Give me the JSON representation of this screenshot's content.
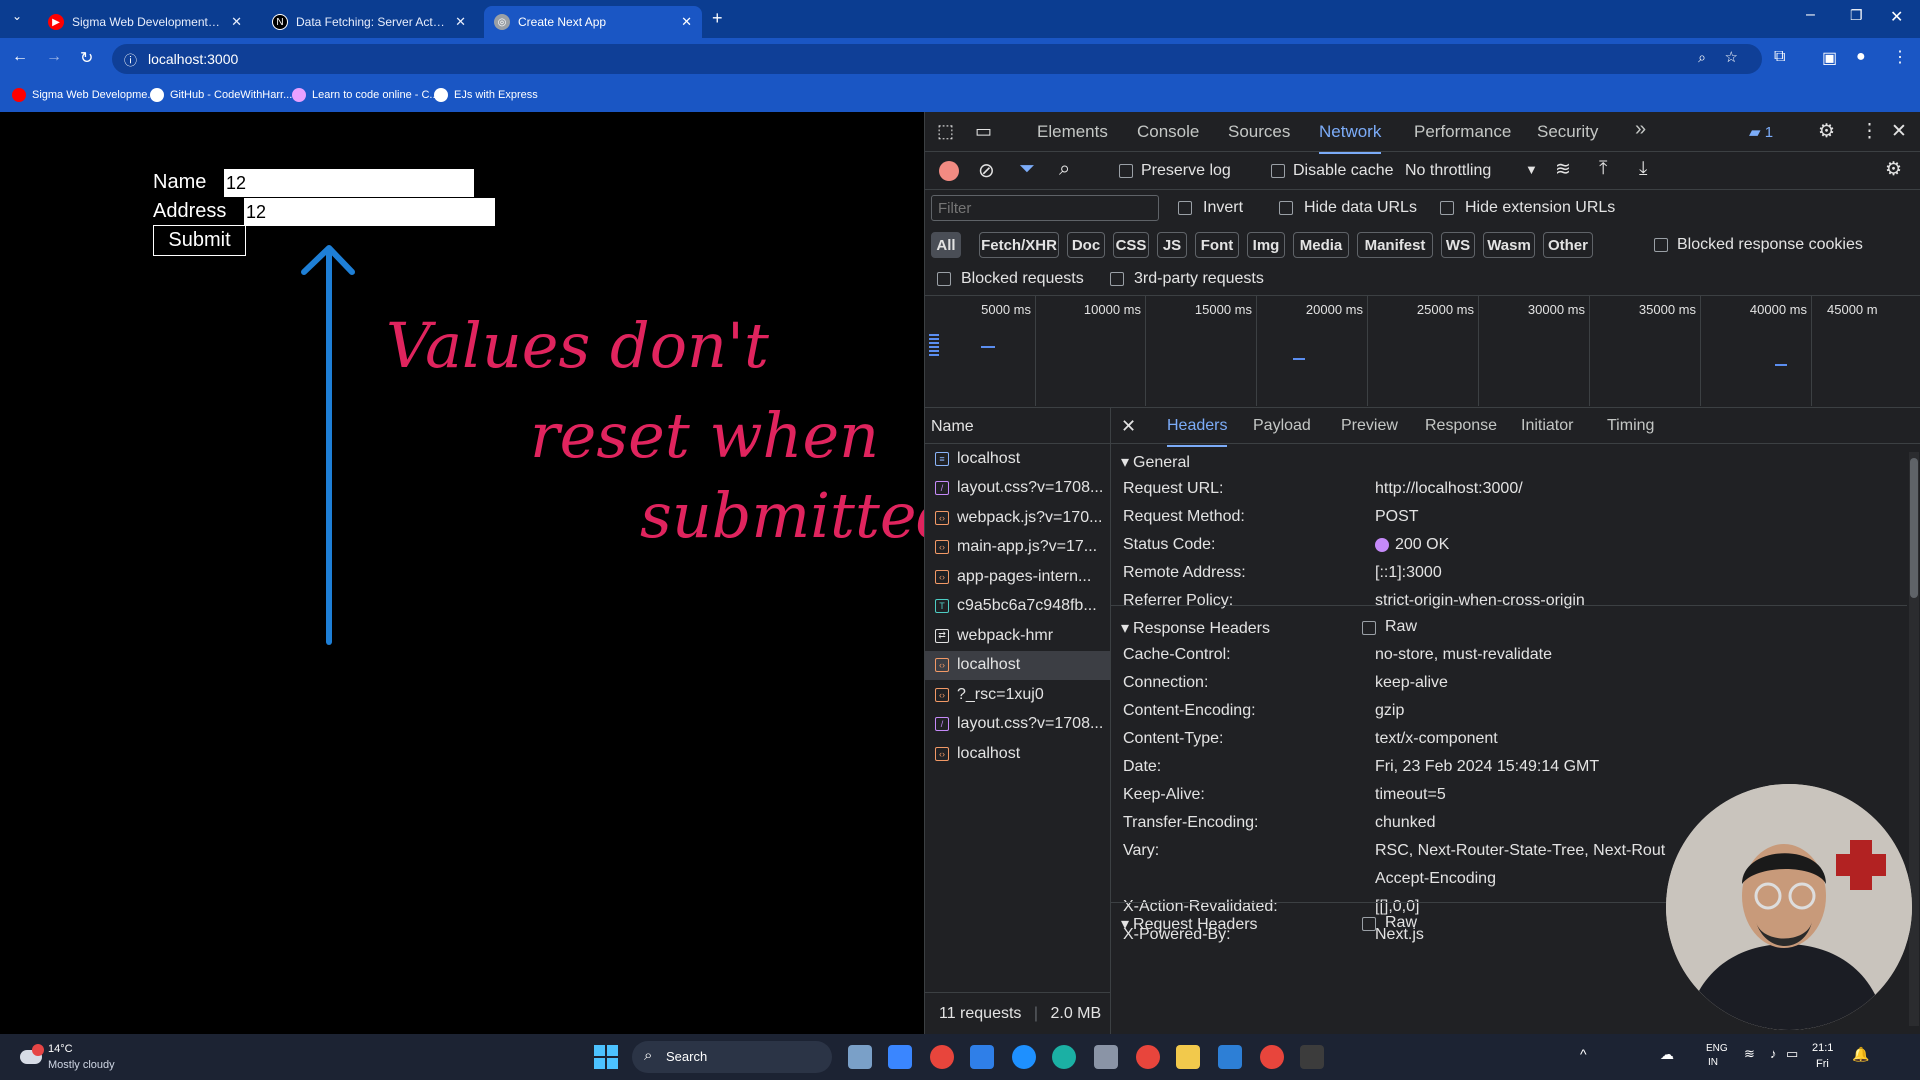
{
  "browser": {
    "tabs": [
      {
        "title": "Sigma Web Development Course - W",
        "favicon_color": "#ff0000"
      },
      {
        "title": "Data Fetching: Server Actions and M",
        "favicon_color": "#000000"
      },
      {
        "title": "Create Next App",
        "favicon_color": "#9aa0a6"
      }
    ],
    "new_tab": "+",
    "url": "localhost:3000",
    "bookmarks": [
      {
        "label": "Sigma Web Developme...",
        "icon_color": "#ff0000"
      },
      {
        "label": "GitHub - CodeWithHarr...",
        "icon_color": "#ffffff"
      },
      {
        "label": "Learn to code online - C...",
        "icon_color": "#e8a0ff"
      },
      {
        "label": "EJs with Express",
        "icon_color": "#ffffff"
      }
    ]
  },
  "page": {
    "form": {
      "name_label": "Name",
      "name_value": "12",
      "address_label": "Address",
      "address_value": "12",
      "submit_label": "Submit"
    },
    "annotation": {
      "line1": "Values don't",
      "line2": "reset when",
      "line3": "submitted",
      "color": "#e0245e",
      "arrow_color": "#1e7fd6"
    }
  },
  "devtools": {
    "panels": [
      "Elements",
      "Console",
      "Sources",
      "Network",
      "Performance",
      "Security"
    ],
    "active_panel": "Network",
    "more": "»",
    "issues_count": "1",
    "controls": {
      "preserve_log": "Preserve log",
      "disable_cache": "Disable cache",
      "throttling": "No throttling"
    },
    "filter": {
      "placeholder": "Filter",
      "invert": "Invert",
      "hide_data_urls": "Hide data URLs",
      "hide_extension_urls": "Hide extension URLs",
      "types": [
        "All",
        "Fetch/XHR",
        "Doc",
        "CSS",
        "JS",
        "Font",
        "Img",
        "Media",
        "Manifest",
        "WS",
        "Wasm",
        "Other"
      ],
      "blocked_response_cookies": "Blocked response cookies",
      "blocked_requests": "Blocked requests",
      "third_party": "3rd-party requests"
    },
    "timeline_ticks": [
      "5000 ms",
      "10000 ms",
      "15000 ms",
      "20000 ms",
      "25000 ms",
      "30000 ms",
      "35000 ms",
      "40000 ms",
      "45000 m"
    ],
    "requests": {
      "header": "Name",
      "items": [
        {
          "name": "localhost",
          "kind": "doc"
        },
        {
          "name": "layout.css?v=1708...",
          "kind": "css"
        },
        {
          "name": "webpack.js?v=170...",
          "kind": "js"
        },
        {
          "name": "main-app.js?v=17...",
          "kind": "js"
        },
        {
          "name": "app-pages-intern...",
          "kind": "js"
        },
        {
          "name": "c9a5bc6a7c948fb...",
          "kind": "font"
        },
        {
          "name": "webpack-hmr",
          "kind": "ws"
        },
        {
          "name": "localhost",
          "kind": "fetch"
        },
        {
          "name": "?_rsc=1xuj0",
          "kind": "fetch"
        },
        {
          "name": "layout.css?v=1708...",
          "kind": "css"
        },
        {
          "name": "localhost",
          "kind": "fetch"
        }
      ],
      "selected_index": 7,
      "summary_count": "11 requests",
      "summary_size": "2.0 MB"
    },
    "detail_tabs": [
      "Headers",
      "Payload",
      "Preview",
      "Response",
      "Initiator",
      "Timing"
    ],
    "active_detail_tab": "Headers",
    "general": {
      "title": "General",
      "rows": [
        {
          "k": "Request URL:",
          "v": "http://localhost:3000/"
        },
        {
          "k": "Request Method:",
          "v": "POST"
        },
        {
          "k": "Status Code:",
          "v": "200 OK"
        },
        {
          "k": "Remote Address:",
          "v": "[::1]:3000"
        },
        {
          "k": "Referrer Policy:",
          "v": "strict-origin-when-cross-origin"
        }
      ]
    },
    "response_headers": {
      "title": "Response Headers",
      "raw": "Raw",
      "rows": [
        {
          "k": "Cache-Control:",
          "v": "no-store, must-revalidate"
        },
        {
          "k": "Connection:",
          "v": "keep-alive"
        },
        {
          "k": "Content-Encoding:",
          "v": "gzip"
        },
        {
          "k": "Content-Type:",
          "v": "text/x-component"
        },
        {
          "k": "Date:",
          "v": "Fri, 23 Feb 2024 15:49:14 GMT"
        },
        {
          "k": "Keep-Alive:",
          "v": "timeout=5"
        },
        {
          "k": "Transfer-Encoding:",
          "v": "chunked"
        },
        {
          "k": "Vary:",
          "v": "RSC, Next-Router-State-Tree, Next-Rout"
        },
        {
          "k": "",
          "v": "Accept-Encoding"
        },
        {
          "k": "X-Action-Revalidated:",
          "v": "[[],0,0]"
        },
        {
          "k": "X-Powered-By:",
          "v": "Next.js"
        }
      ]
    },
    "request_headers": {
      "title": "Request Headers",
      "raw": "Raw"
    }
  },
  "taskbar": {
    "weather_temp": "14°C",
    "weather_desc": "Mostly cloudy",
    "search": "Search",
    "lang1": "ENG",
    "lang2": "IN",
    "time": "21:1",
    "day": "Fri"
  }
}
